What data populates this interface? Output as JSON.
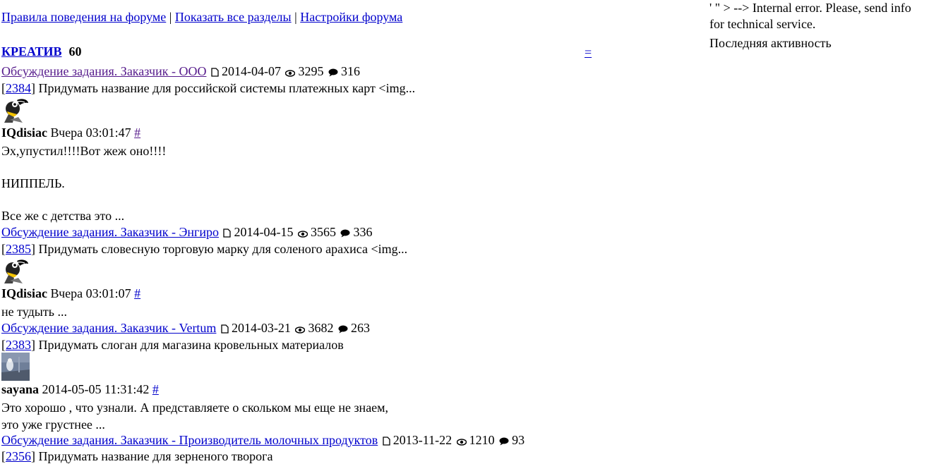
{
  "nav": {
    "rules": "Правила поведения на форуме",
    "sep1": "|",
    "show_all": "Показать все разделы",
    "sep2": "|",
    "settings": "Настройки форума"
  },
  "category": {
    "title": "КРЕАТИВ",
    "count": "60",
    "collapse": "="
  },
  "side": {
    "error": "' \" > --> Internal error. Please, send info for technical service.",
    "activity": "Последняя активность"
  },
  "topics": [
    {
      "title": "Обсуждение задания. Заказчик - ООО",
      "visited": true,
      "date": "2014-04-07",
      "views": "3295",
      "replies": "316",
      "task_open": "[",
      "task_id": "2384",
      "task_close": "]",
      "task_text": " Придумать название для российской системы платежных карт <img...",
      "author": "IQdisiac",
      "time": " Вчера 03:01:47 ",
      "anchor": "#",
      "avatar": "toucan-avatar",
      "text": [
        "Эх,упустил!!!!Вот жеж оно!!!!",
        "",
        "НИППЕЛЬ.",
        "",
        "Все же с детства это ..."
      ]
    },
    {
      "title": "Обсуждение задания. Заказчик - Энгиро",
      "visited": false,
      "date": "2014-04-15",
      "views": "3565",
      "replies": "336",
      "task_open": "[",
      "task_id": "2385",
      "task_close": "]",
      "task_text": " Придумать словесную торговую марку для соленого арахиса <img...",
      "author": "IQdisiac",
      "time": " Вчера 03:01:07 ",
      "anchor": "#",
      "avatar": "toucan-avatar",
      "text": [
        "не тудыть ..."
      ]
    },
    {
      "title": "Обсуждение задания. Заказчик - Vertum",
      "visited": false,
      "date": "2014-03-21",
      "views": "3682",
      "replies": "263",
      "task_open": "[",
      "task_id": "2383",
      "task_close": "]",
      "task_text": " Придумать слоган для магазина кровельных материалов",
      "author": "sayana",
      "time": " 2014-05-05 11:31:42 ",
      "anchor": "#",
      "avatar": "photo-avatar",
      "text": [
        "Это хорошо , что узнали. А представляете о скольком мы еще не знаем,",
        "это уже грустнее ..."
      ]
    },
    {
      "title": "Обсуждение задания. Заказчик - Производитель молочных продуктов",
      "visited": false,
      "date": "2013-11-22",
      "views": "1210",
      "replies": "93",
      "task_open": "[",
      "task_id": "2356",
      "task_close": "]",
      "task_text": " Придумать название для зерненого творога"
    }
  ]
}
